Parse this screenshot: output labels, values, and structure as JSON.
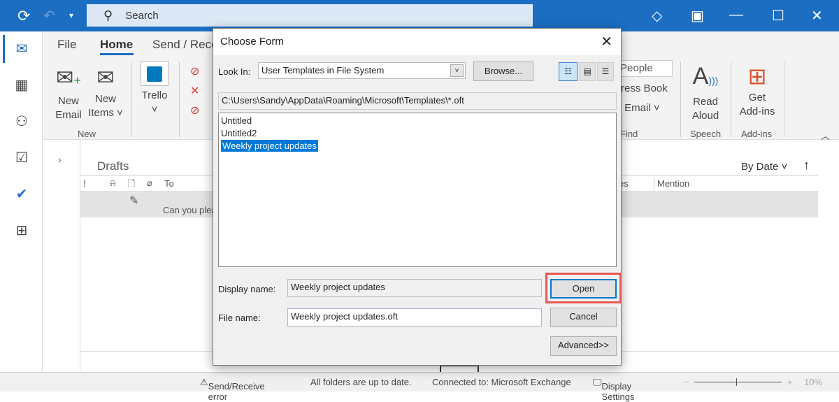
{
  "titlebar": {
    "search_placeholder": "Search"
  },
  "ribbon": {
    "tabs": [
      "File",
      "Home",
      "Send / Rece"
    ],
    "new_email": [
      "New",
      "Email"
    ],
    "new_items": [
      "New",
      "Items ˅"
    ],
    "trello": "Trello",
    "group_new": "New",
    "people": "People",
    "address_book": "ress Book",
    "filter_email": "r Email ˅",
    "group_find": "Find",
    "read_aloud": [
      "Read",
      "Aloud"
    ],
    "group_speech": "Speech",
    "get_addins": [
      "Get",
      "Add-ins"
    ],
    "group_addins": "Add-ins"
  },
  "folder": {
    "title": "Drafts",
    "sort": "By Date",
    "columns": [
      "!",
      "To",
      "es",
      "Mention"
    ],
    "row_preview": "Can you plea"
  },
  "dialog": {
    "title": "Choose Form",
    "look_in_label": "Look In:",
    "look_in_value": "User Templates in File System",
    "browse": "Browse...",
    "path": "C:\\Users\\Sandy\\AppData\\Roaming\\Microsoft\\Templates\\*.oft",
    "items": [
      "Untitled",
      "Untitled2",
      "Weekly project updates"
    ],
    "selected_index": 2,
    "display_name_label": "Display name:",
    "display_name_value": "Weekly project updates",
    "file_name_label": "File name:",
    "file_name_value": "Weekly project updates.oft",
    "open": "Open",
    "cancel": "Cancel",
    "advanced": "Advanced>>"
  },
  "status": {
    "error": "Send/Receive error",
    "folders": "All folders are up to date.",
    "connected": "Connected to: Microsoft Exchange",
    "display_settings": "Display Settings",
    "zoom": "10%"
  },
  "colors": {
    "brand": "#1b6ec2",
    "highlight": "#e8584f",
    "selection": "#0078d7"
  }
}
